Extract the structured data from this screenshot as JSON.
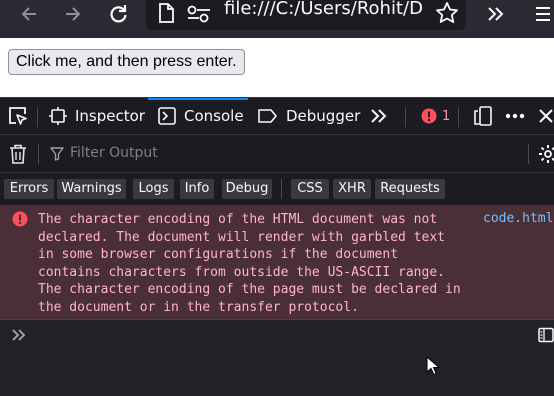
{
  "browser": {
    "url": "file:///C:/Users/Rohit/Deskt"
  },
  "page": {
    "button_label": "Click me, and then press enter."
  },
  "devtools": {
    "tabs": [
      {
        "label": "Inspector",
        "icon": "inspector-icon"
      },
      {
        "label": "Console",
        "icon": "console-icon",
        "active": true
      },
      {
        "label": "Debugger",
        "icon": "debugger-icon"
      }
    ],
    "error_count": "1",
    "filter_placeholder": "Filter Output",
    "categories": [
      "Errors",
      "Warnings",
      "Logs",
      "Info",
      "Debug",
      "CSS",
      "XHR",
      "Requests"
    ],
    "messages": [
      {
        "level": "error",
        "text": "The character encoding of the HTML document was not\ndeclared. The document will render with garbled text\nin some browser configurations if the document\ncontains characters from outside the US-ASCII range.\nThe character encoding of the page must be declared in\nthe document or in the transfer protocol.",
        "source": "code.html"
      }
    ]
  },
  "colors": {
    "devtools_bg": "#1c1b22",
    "accent": "#0a84ff",
    "error_bg": "#4b2f36",
    "error_text": "#ffb3d2",
    "error_icon": "#ff4f5e",
    "link": "#75bfff"
  }
}
